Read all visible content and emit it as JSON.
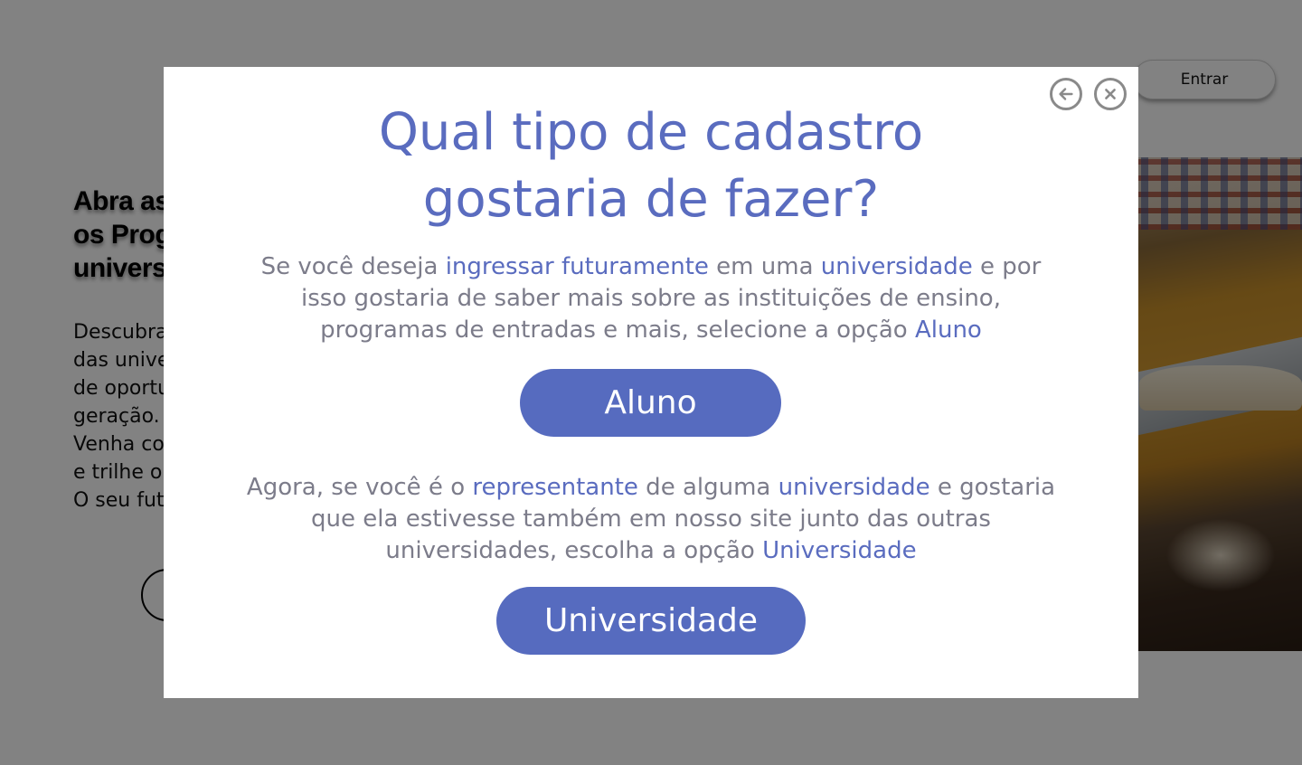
{
  "header": {
    "login_label": "Entrar"
  },
  "hero": {
    "title": "Abra as portas para\nos Programas das\nuniversidades",
    "description": "Descubra as oportunidades\ndas universidades e o mundo\nde oportunidades da nova\ngeração.\nVenha conhecer os programas\ne trilhe o seu caminho.\nO seu futuro começa aqui."
  },
  "modal": {
    "title": "Qual tipo de cadastro\ngostaria de fazer?",
    "back_icon": "arrow-left-circle-icon",
    "close_icon": "x-circle-icon",
    "student_text": {
      "p1": "Se você deseja ",
      "h1": "ingressar futuramente",
      "p2": " em uma ",
      "h2": "universidade",
      "p3": " e por isso gostaria de saber mais sobre as instituições de ensino, programas de entradas e mais, selecione a opção ",
      "h3": "Aluno"
    },
    "student_button": "Aluno",
    "university_text": {
      "p1": "Agora, se você é o ",
      "h1": "representante",
      "p2": " de alguma ",
      "h2": "universidade",
      "p3": " e gostaria que ela estivesse também em nosso site junto das outras universidades, escolha a opção ",
      "h3": "Universidade"
    },
    "university_button": "Universidade"
  },
  "colors": {
    "accent": "#566bbf",
    "body_text": "#7c7c8a",
    "overlay": "rgba(0,0,0,0.49)"
  }
}
